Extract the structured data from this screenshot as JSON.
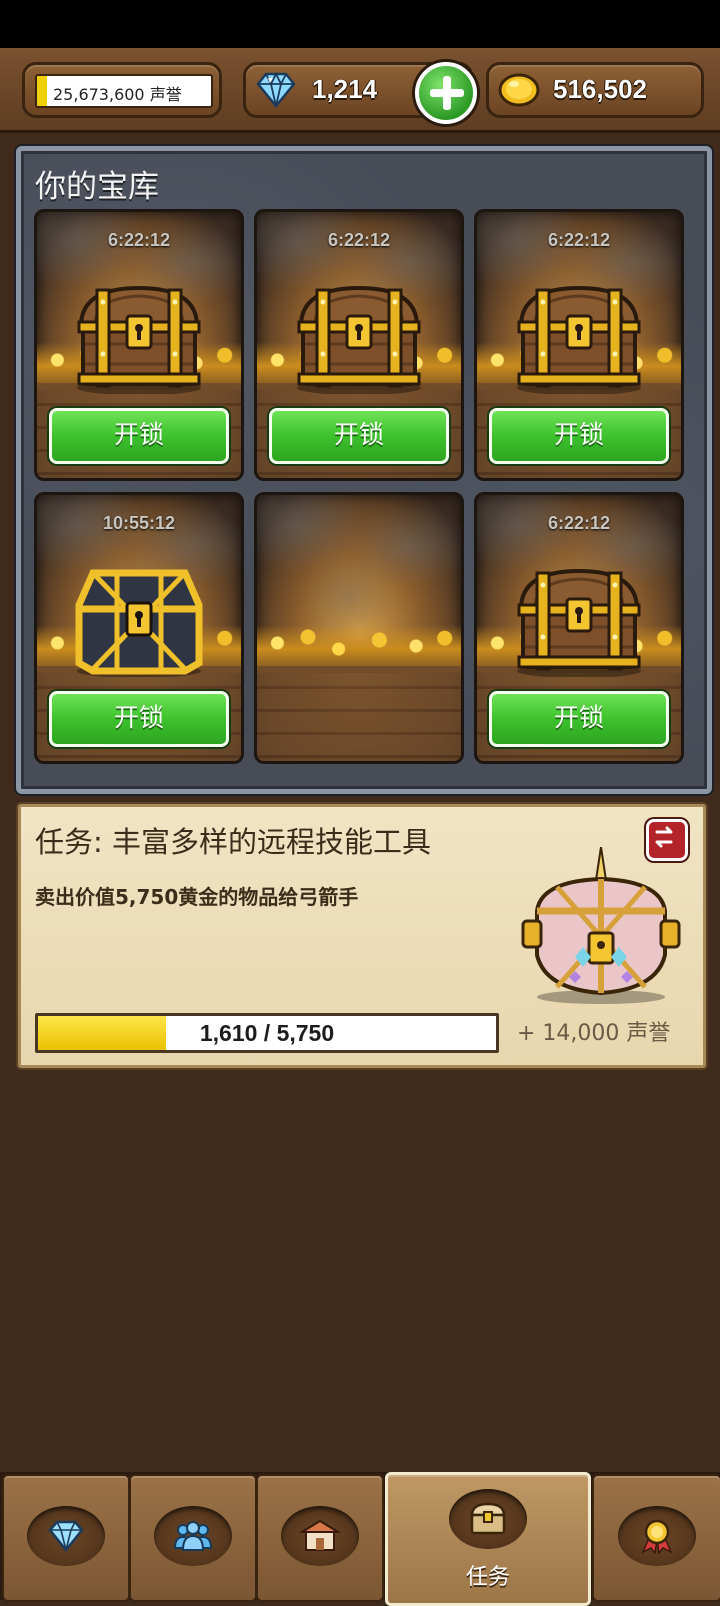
{
  "resources": {
    "reputation_text": "25,673,600 声誉",
    "reputation_fill": 0.06,
    "gems": "1,214",
    "gold": "516,502"
  },
  "vault": {
    "title": "你的宝库",
    "slots": [
      {
        "timer": "6:22:12",
        "chest": "wooden-chest",
        "button": "开锁"
      },
      {
        "timer": "6:22:12",
        "chest": "wooden-chest",
        "button": "开锁"
      },
      {
        "timer": "6:22:12",
        "chest": "wooden-chest",
        "button": "开锁"
      },
      {
        "timer": "10:55:12",
        "chest": "iron-chest",
        "button": "开锁"
      },
      {
        "timer": "",
        "chest": "empty",
        "button": ""
      },
      {
        "timer": "6:22:12",
        "chest": "wooden-chest",
        "button": "开锁"
      }
    ]
  },
  "quest": {
    "title": "任务: 丰富多样的远程技能工具",
    "description": "卖出价值5,750黄金的物品给弓箭手",
    "progress_text": "1,610 / 5,750",
    "progress_value": 1610,
    "progress_max": 5750,
    "reward": "+ 14,000 声誉"
  },
  "nav": {
    "tabs": [
      {
        "icon": "gem-icon"
      },
      {
        "icon": "group-icon"
      },
      {
        "icon": "market-icon"
      },
      {
        "icon": "chest-icon",
        "label": "任务",
        "active": true
      },
      {
        "icon": "medal-icon"
      }
    ]
  },
  "colors": {
    "unlock_green": "#3dc22d",
    "progress_yellow": "#ffe54a",
    "background_brown": "#3f2a1c"
  }
}
